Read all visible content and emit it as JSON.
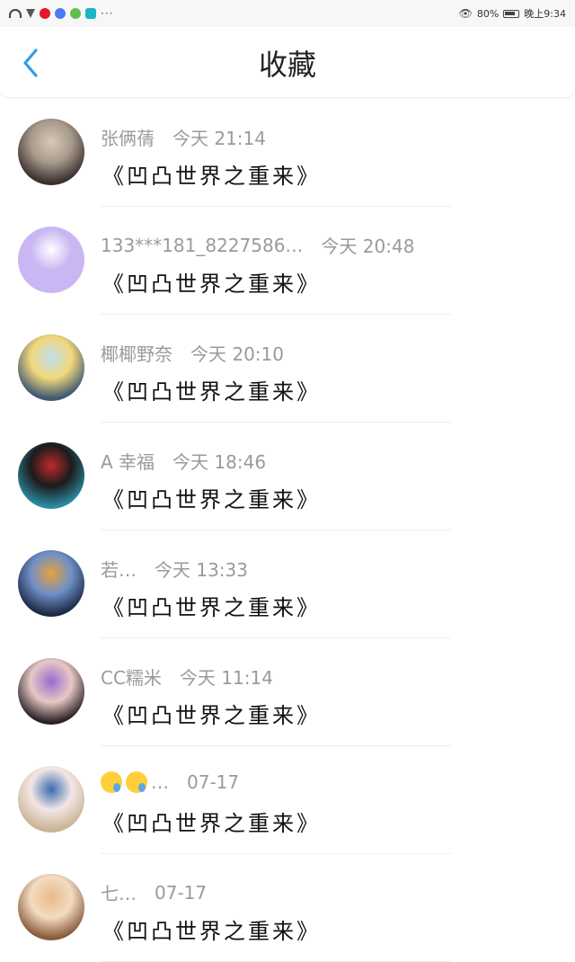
{
  "status_bar": {
    "left_dots": "···",
    "battery_percent": "80",
    "time": "晚上9:34"
  },
  "header": {
    "title": "收藏"
  },
  "favorites": [
    {
      "name": "张俩蒨",
      "time": "今天 21:14",
      "title": "《凹凸世界之重来》",
      "avatar_colors": [
        "#3b2f2f",
        "#a89a8c",
        "#d8c9b8"
      ]
    },
    {
      "name": "133***181_8227586…",
      "time": "今天 20:48",
      "title": "《凹凸世界之重来》",
      "avatar_colors": [
        "#c9b6f2",
        "#c9b6f2",
        "#ffffff"
      ]
    },
    {
      "name": "椰椰野奈",
      "time": "今天 20:10",
      "title": "《凹凸世界之重来》",
      "avatar_colors": [
        "#3d5873",
        "#f2d77a",
        "#bfe0f0"
      ]
    },
    {
      "name": "A   幸福",
      "time": "今天 18:46",
      "title": "《凹凸世界之重来》",
      "avatar_colors": [
        "#2a8aa0",
        "#1b1b1b",
        "#c0282b"
      ]
    },
    {
      "name": "若…",
      "time": "今天 13:33",
      "title": "《凹凸世界之重来》",
      "avatar_colors": [
        "#1d2a44",
        "#6f8fc7",
        "#e6a23c"
      ]
    },
    {
      "name": "CC糯米",
      "time": "今天 11:14",
      "title": "《凹凸世界之重来》",
      "avatar_colors": [
        "#2b2226",
        "#e7c8c4",
        "#9a6ad0"
      ]
    },
    {
      "name": "…",
      "time": "07-17",
      "title": "《凹凸世界之重来》",
      "avatar_colors": [
        "#c8b494",
        "#f4e6e6",
        "#3a6ab0"
      ],
      "emoji_count": 2
    },
    {
      "name": "七…",
      "time": "07-17",
      "title": "《凹凸世界之重来》",
      "avatar_colors": [
        "#8a5a3c",
        "#f3dcc0",
        "#e8b98a"
      ]
    }
  ],
  "colors": {
    "accent": "#2f9be8",
    "meta_text": "#9a9a9a",
    "title_text": "#111111"
  }
}
